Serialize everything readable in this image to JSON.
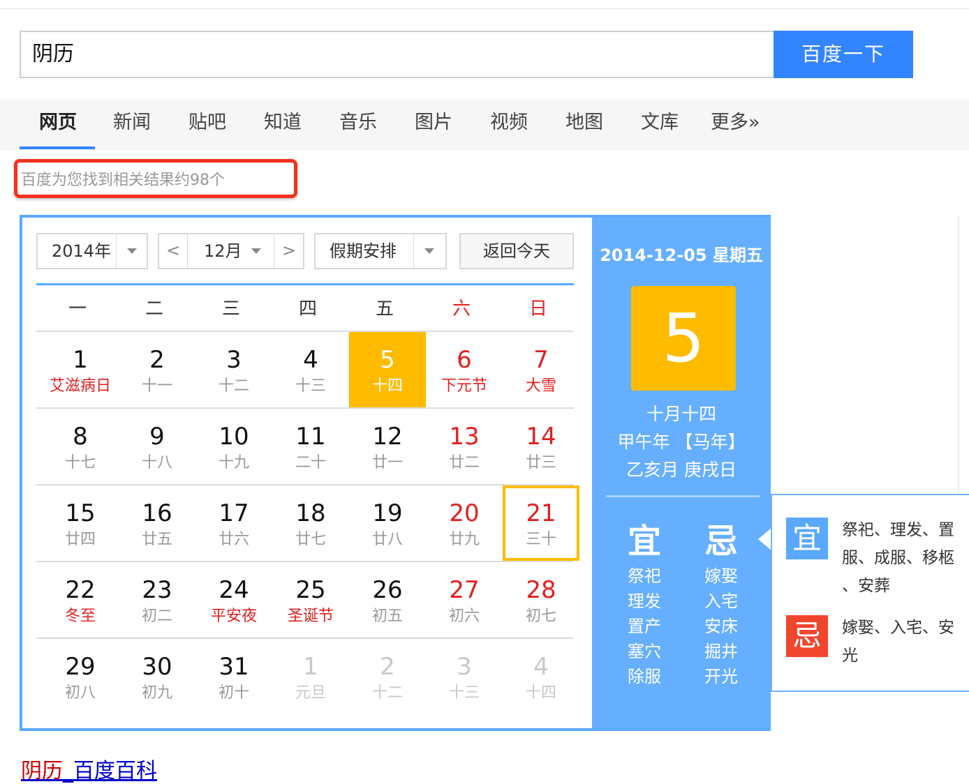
{
  "search": {
    "query": "阴历",
    "button": "百度一下"
  },
  "nav": {
    "items": [
      "网页",
      "新闻",
      "贴吧",
      "知道",
      "音乐",
      "图片",
      "视频",
      "地图",
      "文库",
      "更多»"
    ],
    "active": 0
  },
  "result_count": "百度为您找到相关结果约98个",
  "calendar": {
    "year": "2014年",
    "month": "12月",
    "holiday": "假期安排",
    "today_btn": "返回今天",
    "prev": "<",
    "next": ">",
    "weekdays": [
      "一",
      "二",
      "三",
      "四",
      "五",
      "六",
      "日"
    ],
    "weeks": [
      [
        [
          "1",
          "艾滋病日"
        ],
        [
          "2",
          "十一"
        ],
        [
          "3",
          "十二"
        ],
        [
          "4",
          "十三"
        ],
        [
          "5",
          "十四"
        ],
        [
          "6",
          "下元节"
        ],
        [
          "7",
          "大雪"
        ]
      ],
      [
        [
          "8",
          "十七"
        ],
        [
          "9",
          "十八"
        ],
        [
          "10",
          "十九"
        ],
        [
          "11",
          "二十"
        ],
        [
          "12",
          "廿一"
        ],
        [
          "13",
          "廿二"
        ],
        [
          "14",
          "廿三"
        ]
      ],
      [
        [
          "15",
          "廿四"
        ],
        [
          "16",
          "廿五"
        ],
        [
          "17",
          "廿六"
        ],
        [
          "18",
          "廿七"
        ],
        [
          "19",
          "廿八"
        ],
        [
          "20",
          "廿九"
        ],
        [
          "21",
          "三十"
        ]
      ],
      [
        [
          "22",
          "冬至"
        ],
        [
          "23",
          "初二"
        ],
        [
          "24",
          "平安夜"
        ],
        [
          "25",
          "圣诞节"
        ],
        [
          "26",
          "初五"
        ],
        [
          "27",
          "初六"
        ],
        [
          "28",
          "初七"
        ]
      ],
      [
        [
          "29",
          "初八"
        ],
        [
          "30",
          "初九"
        ],
        [
          "31",
          "初十"
        ],
        [
          "1",
          "元旦"
        ],
        [
          "2",
          "十二"
        ],
        [
          "3",
          "十三"
        ],
        [
          "4",
          "十四"
        ]
      ]
    ],
    "festival_cells": [
      "0-0",
      "0-5",
      "0-6",
      "3-0",
      "3-2",
      "3-3"
    ],
    "other_month_cells": [
      "4-3",
      "4-4",
      "4-5",
      "4-6"
    ],
    "selected_cell": "0-4",
    "today_cell": "2-6",
    "accent_color": "#ffbb00",
    "panel_color": "#66afff"
  },
  "detail": {
    "date": "2014-12-05 星期五",
    "day": "5",
    "lunar_date": "十月十四",
    "ganzhi_year": "甲午年 【马年】",
    "ganzhi_month_day": "乙亥月 庚戌日",
    "yi_label": "宜",
    "ji_label": "忌",
    "yi": [
      "祭祀",
      "理发",
      "置产",
      "塞穴",
      "除服"
    ],
    "ji": [
      "嫁娶",
      "入宅",
      "安床",
      "掘井",
      "开光"
    ]
  },
  "popup": {
    "yi_badge": "宜",
    "ji_badge": "忌",
    "yi_lines": [
      "祭祀、理发、置",
      "服、成服、移柩",
      "、安葬"
    ],
    "ji_lines": [
      "嫁娶、入宅、安",
      "光"
    ]
  },
  "bottom_link": {
    "keyword": "阴历",
    "rest": "_百度百科"
  }
}
